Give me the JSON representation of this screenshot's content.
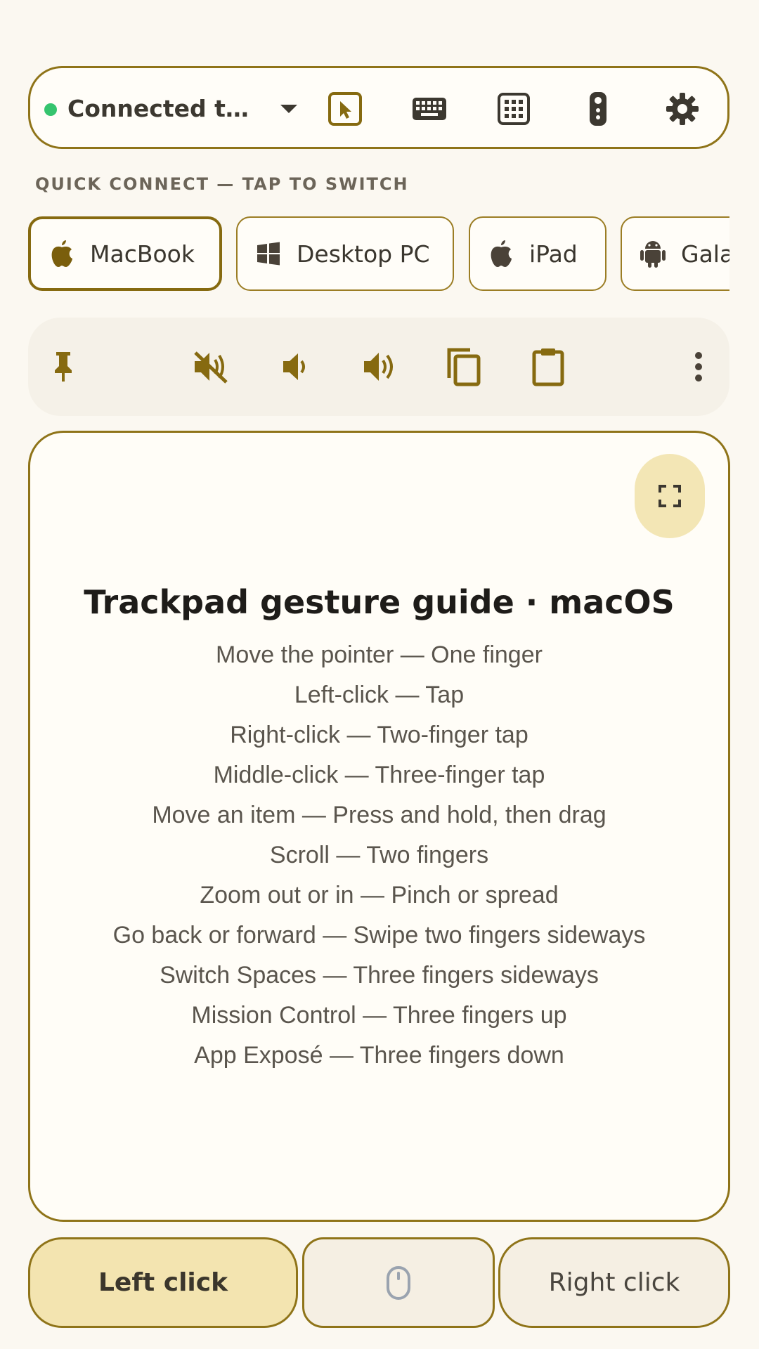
{
  "connection": {
    "status_label": "Connected to …",
    "status_color": "#35C46E"
  },
  "toolbar": {
    "icons": [
      "dropdown-arrow-icon",
      "pointer-icon",
      "keyboard-icon",
      "numpad-icon",
      "remote-icon",
      "gear-icon"
    ]
  },
  "quick_connect": {
    "label": "QUICK CONNECT — TAP TO SWITCH",
    "devices": [
      {
        "name": "MacBook",
        "icon": "apple-icon",
        "active": true
      },
      {
        "name": "Desktop PC",
        "icon": "windows-icon",
        "active": false
      },
      {
        "name": "iPad",
        "icon": "apple-icon",
        "active": false
      },
      {
        "name": "Galaxy",
        "icon": "android-icon",
        "active": false
      }
    ]
  },
  "actions": {
    "icons": [
      "pin-icon",
      "mute-icon",
      "volume-down-icon",
      "volume-up-icon",
      "copy-icon",
      "clipboard-icon",
      "more-vert-icon"
    ]
  },
  "trackpad": {
    "title": "Trackpad gesture guide · macOS",
    "gestures": [
      "Move the pointer — One finger",
      "Left-click — Tap",
      "Right-click — Two-finger tap",
      "Middle-click — Three-finger tap",
      "Move an item — Press and hold, then drag",
      "Scroll — Two fingers",
      "Zoom out or in — Pinch or spread",
      "Go back or forward — Swipe two fingers sideways",
      "Switch Spaces — Three fingers sideways",
      "Mission Control — Three fingers up",
      "App Exposé — Three fingers down"
    ]
  },
  "mouse_buttons": {
    "left": "Left click",
    "right": "Right click"
  },
  "colors": {
    "accent": "#8F7419",
    "accent_fill": "#F3E4B0"
  }
}
